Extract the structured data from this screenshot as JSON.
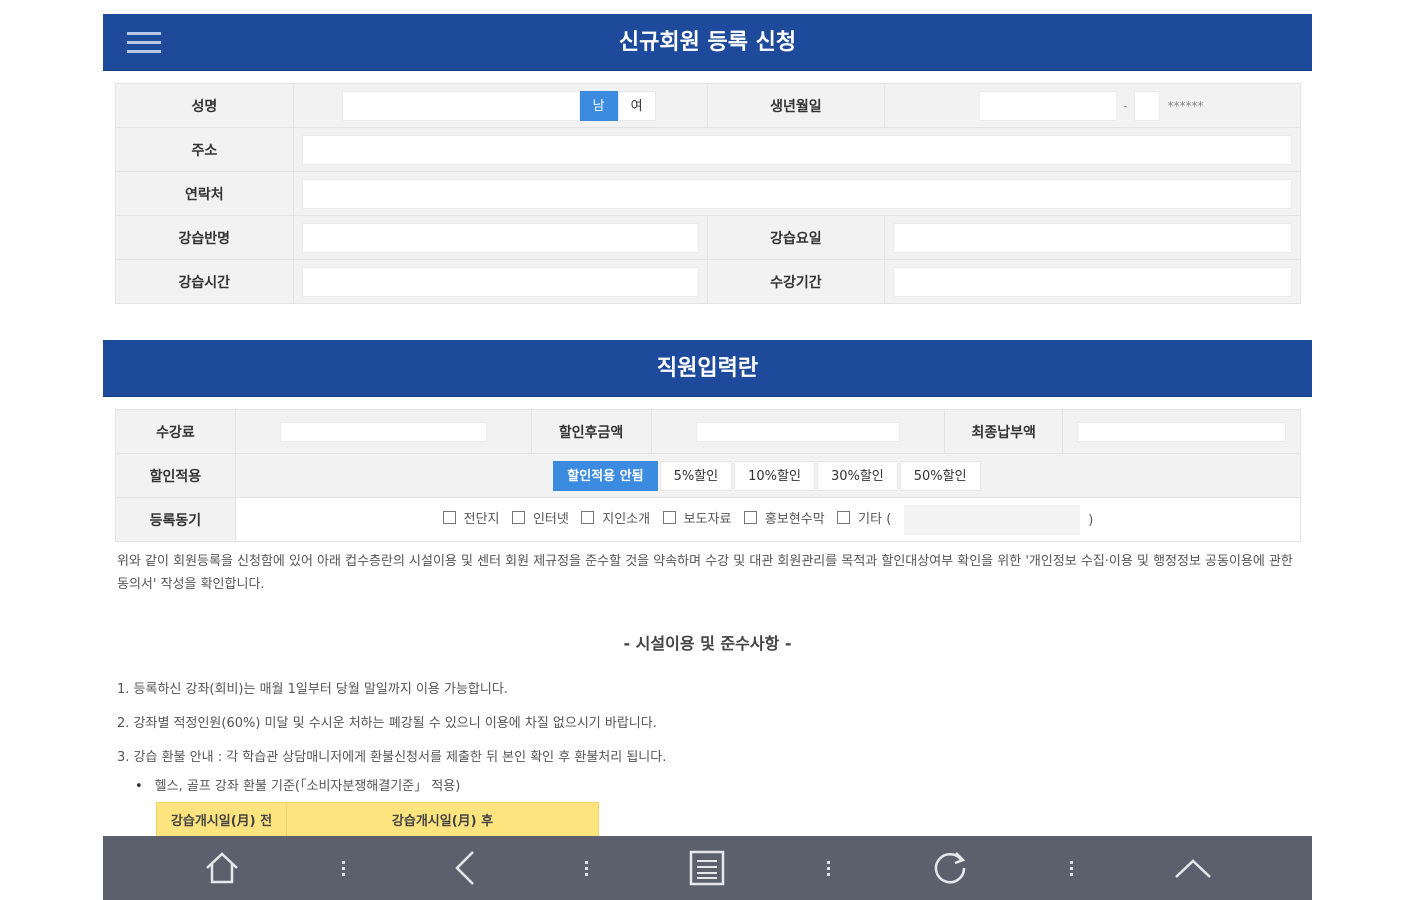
{
  "header": {
    "title": "신규회원 등록 신청"
  },
  "applicant": {
    "name_label": "성명",
    "gender_male": "남",
    "gender_female": "여",
    "birth_label": "생년월일",
    "birth_mask": "******",
    "birth_sep": "-",
    "address_label": "주소",
    "phone_label": "연락처",
    "course_label": "강습반명",
    "day_label": "강습요일",
    "time_label": "강습시간",
    "period_label": "수강기간"
  },
  "staff": {
    "title": "직원입력란",
    "fee_label": "수강료",
    "discounted_label": "할인후금액",
    "final_label": "최종납부액",
    "discount_label": "할인적용",
    "discount_options": [
      "할인적용 안됨",
      "5%할인",
      "10%할인",
      "30%할인",
      "50%할인"
    ],
    "motive_label": "등록동기",
    "motive_options": [
      "전단지",
      "인터넷",
      "지인소개",
      "보도자료",
      "홍보현수막",
      "기타 ("
    ],
    "motive_close": ")"
  },
  "notice": {
    "text": "위와 같이 회원등록을 신청함에 있어 아래 컵수층란의 시설이용 및 센터 회원 제규정을 준수할 것을 약속하며 수강 및 대관 회원관리를 목적과 할인대상여부 확인을 위한 '개인정보 수집·이용 및 행정정보 공동이용에 관한 동의서' 작성을 확인합니다.",
    "section_title": "- 시설이용 및 준수사항 -",
    "rules": [
      "1. 등록하신 강좌(회비)는 매월 1일부터 당월 말일까지 이용 가능합니다.",
      "2. 강좌별 적정인원(60%) 미달 및 수시운 처하는 폐강될 수 있으니 이용에 차질 없으시기 바랍니다.",
      "3. 강습 환불 안내 : 각 학습관 상담매니저에게 환불신청서를 제출한 뒤 본인 확인 후 환불처리 됩니다."
    ],
    "bullet": "헬스, 골프 강좌 환불 기준(「소비자분쟁해결기준」 적용)",
    "refund_before": "강습개시일(月) 전",
    "refund_after": "강습개시일(月) 후"
  },
  "colors": {
    "brand": "#1d4a9a",
    "accent": "#3b8be0",
    "bottom_bar": "#5b606c",
    "highlight": "#fde47f"
  },
  "bottom_nav": [
    "home-icon",
    "back-icon",
    "document-icon",
    "refresh-icon",
    "up-icon"
  ]
}
